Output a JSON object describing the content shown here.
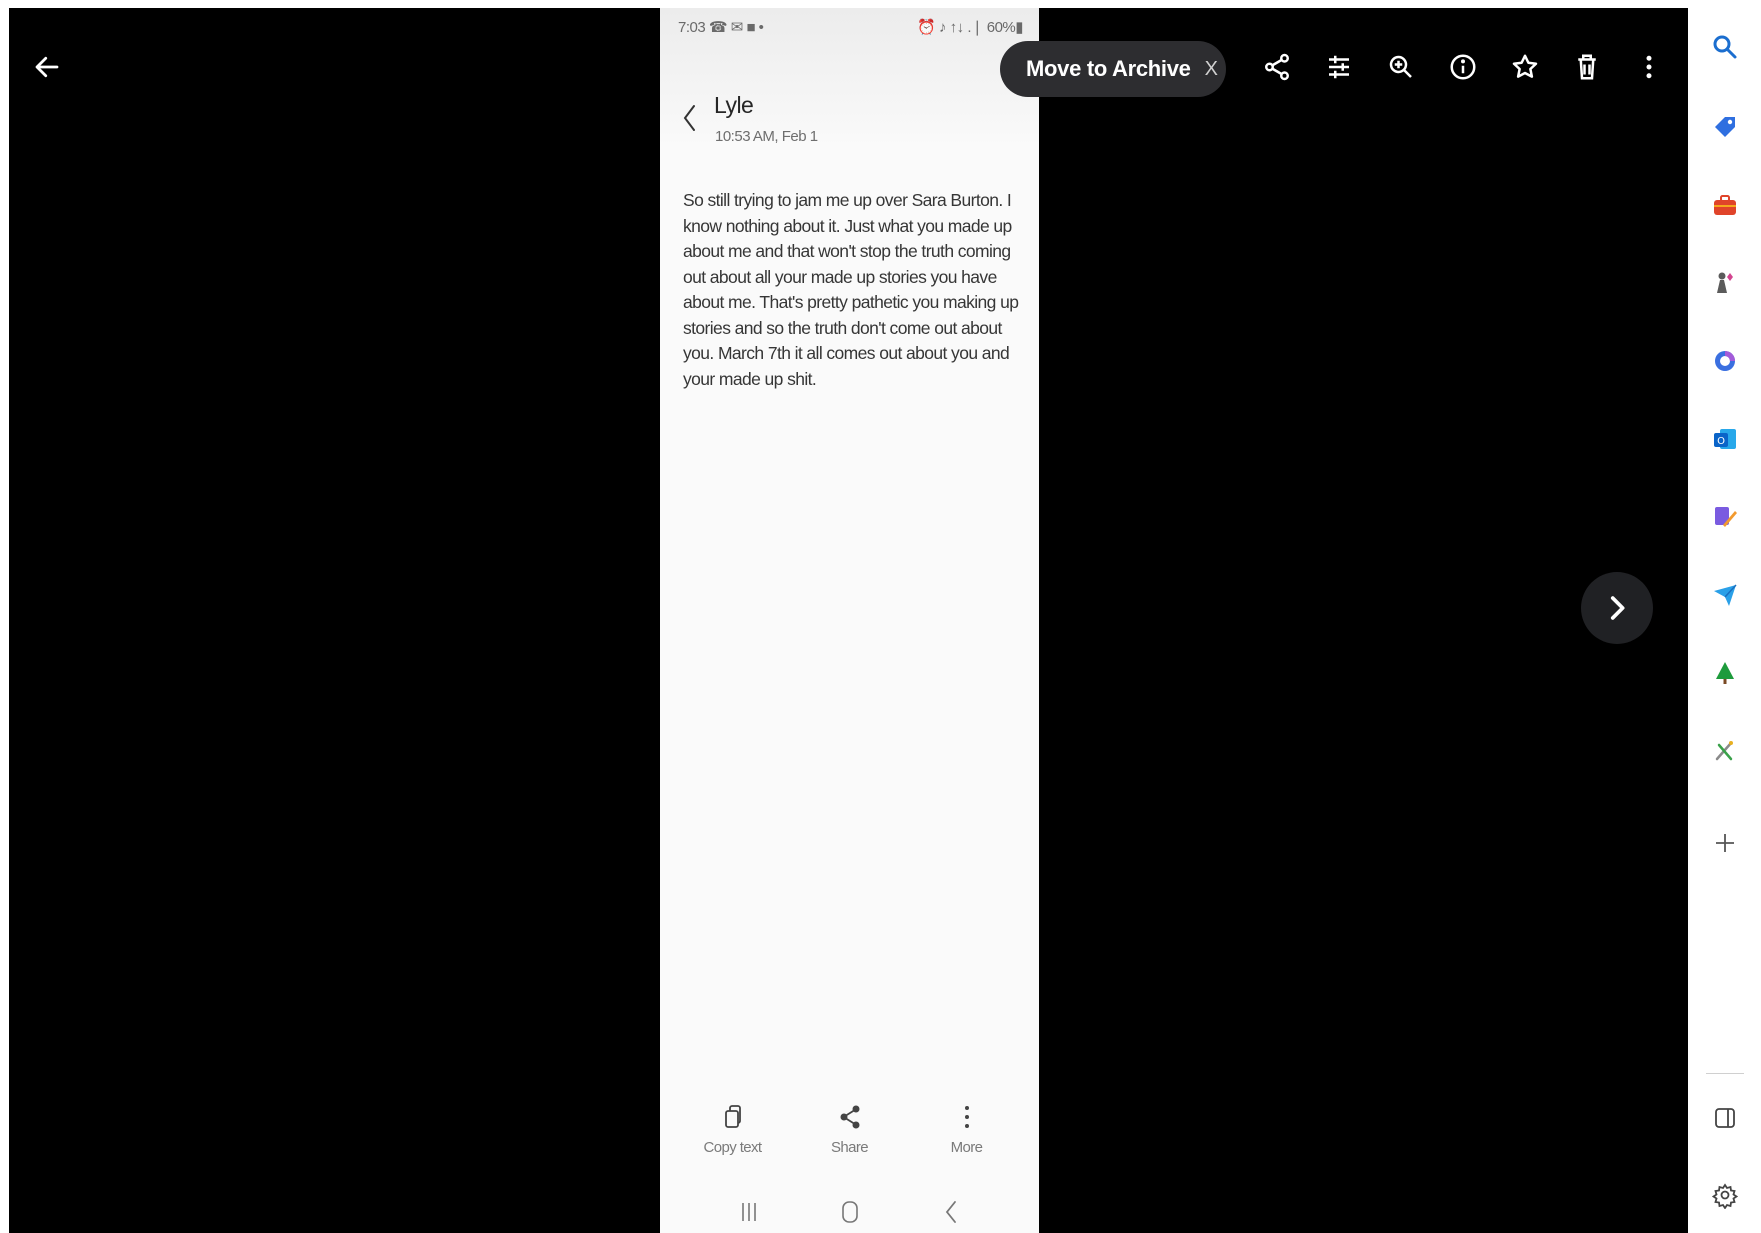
{
  "viewer": {
    "back_icon": "arrow-left-icon",
    "next_icon": "chevron-right-icon",
    "toolbar": [
      "share-icon",
      "edit-sliders-icon",
      "zoom-in-icon",
      "info-icon",
      "star-icon",
      "trash-icon",
      "more-vertical-icon"
    ]
  },
  "toast": {
    "icon": "archive-icon",
    "label": "Move to Archive",
    "close": "X"
  },
  "phone": {
    "status_left": "7:03 ☎ ✉ ■ •",
    "status_right": "⏰ ♪ ↑↓ .❘ 60%▮",
    "contact": "Lyle",
    "time": "10:53 AM, Feb 1",
    "message": "So still trying to jam me up over Sara Burton. I know nothing about it. Just what you made up about me and that won't stop the truth coming out about all your made up stories you have about me. That's pretty pathetic you making up stories and so the truth don't come out about you. March 7th it all comes out about you and your made up shit.",
    "actions": {
      "copy": "Copy text",
      "share": "Share",
      "more": "More"
    }
  },
  "sidebar": {
    "items": [
      "search-icon",
      "tag-icon",
      "briefcase-icon",
      "games-icon",
      "copilot-icon",
      "outlook-icon",
      "designer-icon",
      "send-icon",
      "tree-icon",
      "tool-icon",
      "plus-icon"
    ],
    "bottom": [
      "sidebar-toggle-icon",
      "settings-icon"
    ]
  },
  "colors": {
    "viewer_bg": "#000000",
    "toast_bg": "#2d2d30",
    "phone_bg": "#fafafa",
    "nav_circle": "#202124"
  }
}
